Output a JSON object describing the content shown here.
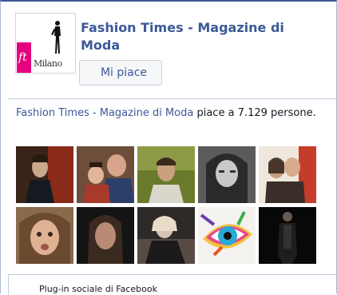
{
  "page": {
    "name": "Fashion Times - Magazine di Moda",
    "like_button_label": "Mi piace"
  },
  "logo": {
    "ft_text": "ft",
    "milano_text": "Milano",
    "accent_color": "#e5007e"
  },
  "social": {
    "page_link": "Fashion Times - Magazine di Moda",
    "suffix": " piace a 7.129 persone."
  },
  "faces": [
    {
      "name": "friend-face-1"
    },
    {
      "name": "friend-face-2"
    },
    {
      "name": "friend-face-3"
    },
    {
      "name": "friend-face-4"
    },
    {
      "name": "friend-face-5"
    },
    {
      "name": "friend-face-6"
    },
    {
      "name": "friend-face-7"
    },
    {
      "name": "friend-face-8"
    },
    {
      "name": "friend-face-9"
    },
    {
      "name": "friend-face-10"
    }
  ],
  "footer": {
    "plugin_label": "Plug-in sociale di Facebook"
  },
  "colors": {
    "facebook_blue": "#3b5998",
    "border": "#aab8d4"
  }
}
